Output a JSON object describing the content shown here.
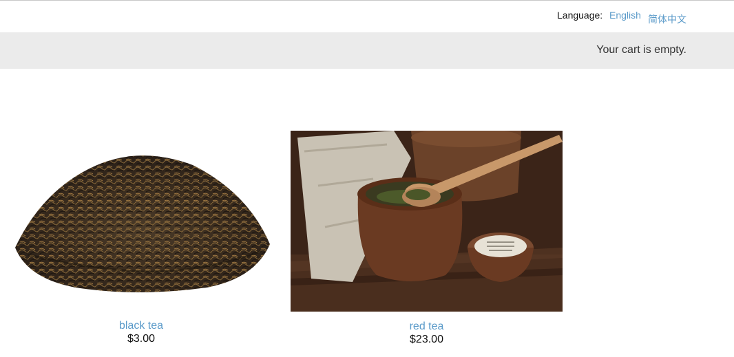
{
  "language_bar": {
    "label": "Language:",
    "options": [
      "English",
      "简体中文"
    ]
  },
  "cart": {
    "status": "Your cart is empty."
  },
  "products": [
    {
      "name": "black tea",
      "price": "$3.00"
    },
    {
      "name": "red tea",
      "price": "$23.00"
    }
  ]
}
